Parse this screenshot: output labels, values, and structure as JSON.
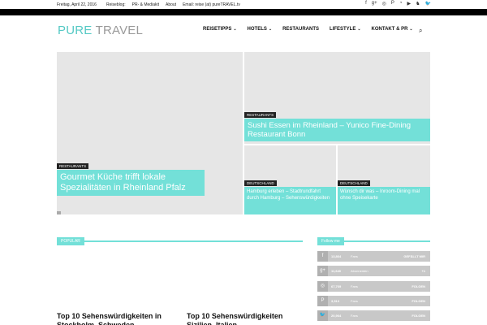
{
  "topbar": {
    "date": "Freitag, April 22, 2016",
    "links": [
      "Reiseblog:",
      "PR- & Mediakit",
      "About",
      "Email: reise (at) pureTRAVEL.tv"
    ],
    "social_icons": [
      "f",
      "g+",
      "◎",
      "P",
      "◔",
      "▶",
      "♞",
      "🐦"
    ]
  },
  "logo": {
    "part1": "PURE",
    "part2": " TRAVEL"
  },
  "nav": {
    "items": [
      {
        "label": "REISETIPPS",
        "chev": "⌄"
      },
      {
        "label": "HOTELS",
        "chev": "⌄"
      },
      {
        "label": "RESTAURANTS",
        "chev": ""
      },
      {
        "label": "LIFESTYLE",
        "chev": "⌄"
      },
      {
        "label": "KONTAKT & PR",
        "chev": "⌄"
      }
    ],
    "search_icon": "⌕"
  },
  "hero": {
    "big": {
      "category": "RESTAURANTS",
      "title": "Gourmet Küche trifft lokale Spezialitäten in Rheinland Pfalz"
    },
    "top": {
      "category": "RESTAURANTS",
      "title": "Sushi Essen im Rheinland – Yunico Fine-Dining Restaurant Bonn"
    },
    "small1": {
      "category": "DEUTSCHLAND",
      "title": "Hamburg erleben – Stadtrundfahrt durch Hamburg – Sehenswürdigkeiten"
    },
    "small2": {
      "category": "DEUTSCHLAND",
      "title": "Wünsch dir was – Inroom-Dining mal ohne Speisekarte"
    }
  },
  "popular": {
    "label": "POPULAR",
    "posts": [
      {
        "title": "Top 10 Sehenswürdigkeiten in Stockholm, Schweden"
      },
      {
        "title": "Top 10 Sehenswürdigkeiten Sizilien, Italien"
      }
    ]
  },
  "follow": {
    "label": "Follow me",
    "rows": [
      {
        "icon": "f",
        "count": "13,864",
        "unit": "Fans",
        "action": "GEFÄLLT MIR"
      },
      {
        "icon": "g+",
        "count": "11,640",
        "unit": "Abonnenten",
        "action": "+1"
      },
      {
        "icon": "◎",
        "count": "67,769",
        "unit": "Fans",
        "action": "FOLGEN"
      },
      {
        "icon": "P",
        "count": "3,513",
        "unit": "Fans",
        "action": "FOLGEN"
      },
      {
        "icon": "🐦",
        "count": "20,964",
        "unit": "Fans",
        "action": "FOLGEN"
      }
    ]
  }
}
